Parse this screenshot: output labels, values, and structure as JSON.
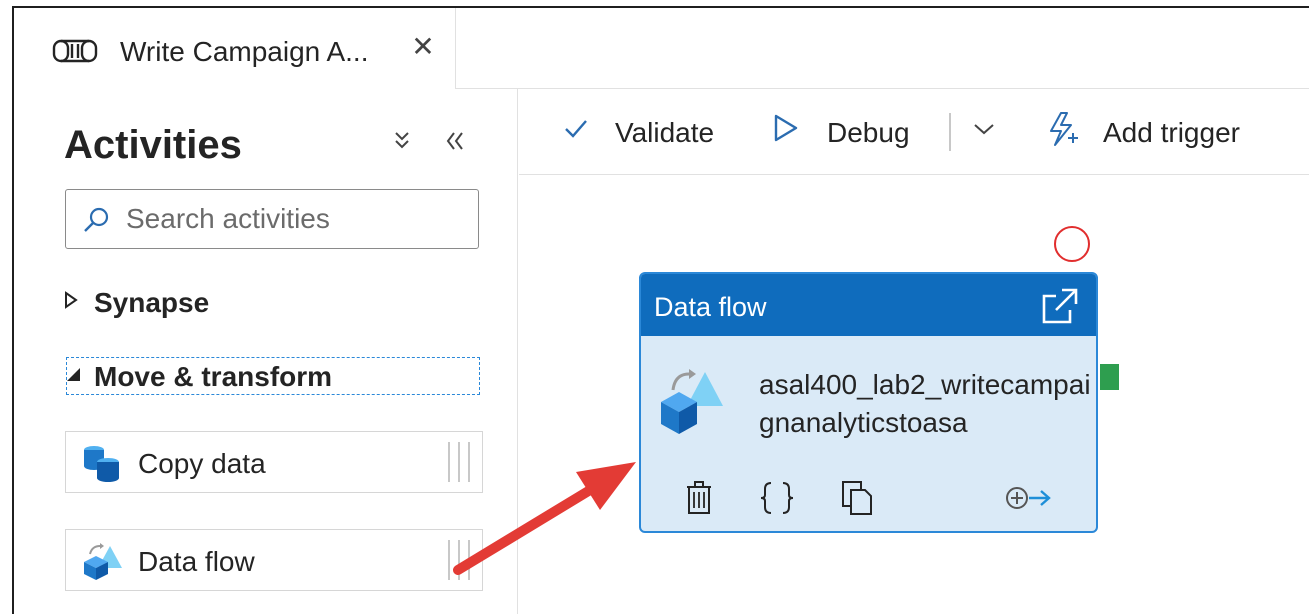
{
  "tab": {
    "title": "Write Campaign A...",
    "close_symbol": "✕",
    "icon": "pipeline-icon"
  },
  "activities": {
    "title": "Activities",
    "collapse_all_symbol": "≫",
    "hide_panel_symbol": "«",
    "search": {
      "placeholder": "Search activities",
      "value": ""
    },
    "categories": [
      {
        "label": "Synapse",
        "expanded": false,
        "caret": "▷"
      },
      {
        "label": "Move & transform",
        "expanded": true,
        "caret": "◢"
      }
    ],
    "items": [
      {
        "label": "Copy data",
        "icon": "copy-data-icon"
      },
      {
        "label": "Data flow",
        "icon": "data-flow-icon"
      }
    ]
  },
  "toolbar": {
    "validate_label": "Validate",
    "debug_label": "Debug",
    "add_trigger_label": "Add trigger"
  },
  "canvas": {
    "node": {
      "type_label": "Data flow",
      "name": "asal400_lab2_writecampaignanalyticstoasa",
      "actions": [
        "delete-icon",
        "code-icon",
        "clone-icon",
        "add-output-icon"
      ]
    }
  },
  "colors": {
    "accent": "#0f6cbd",
    "node_fill": "#daeaf7",
    "annotation_red": "#e12e2e",
    "success_port": "#2e9e4f"
  }
}
